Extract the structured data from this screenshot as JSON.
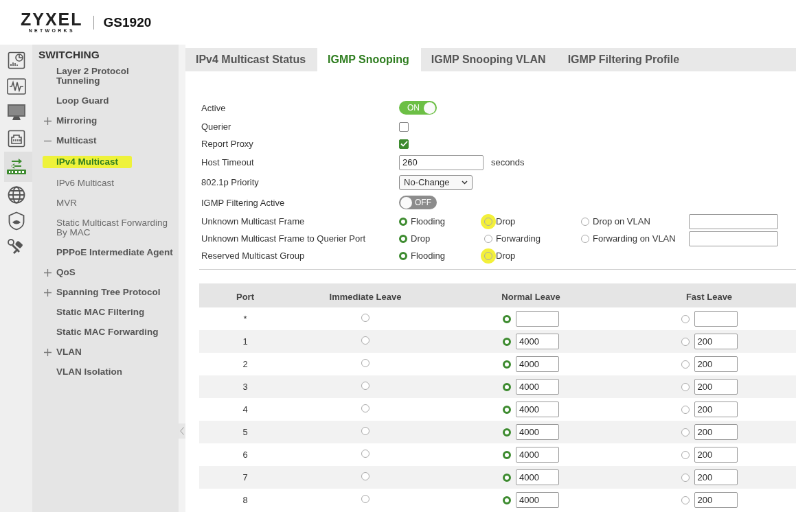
{
  "header": {
    "logo": "ZYXEL",
    "logo_sub": "NETWORKS",
    "model": "GS1920"
  },
  "rail": [
    {
      "kind": "dashboard",
      "selected": false
    },
    {
      "kind": "monitor",
      "selected": false
    },
    {
      "kind": "screen",
      "selected": false
    },
    {
      "kind": "port",
      "selected": false
    },
    {
      "kind": "switching",
      "selected": true
    },
    {
      "kind": "globe",
      "selected": false
    },
    {
      "kind": "shield",
      "selected": false
    },
    {
      "kind": "tools",
      "selected": false
    }
  ],
  "sidebar": {
    "title": "SWITCHING",
    "items": [
      {
        "label": "Layer 2 Protocol Tunneling",
        "selected": false
      },
      {
        "label": "Loop Guard",
        "selected": false
      },
      {
        "label": "Mirroring",
        "selected": false,
        "expanded": false
      },
      {
        "label": "Multicast",
        "selected": false,
        "expanded": true,
        "children": [
          {
            "label": "IPv4 Multicast",
            "selected": true,
            "highlighted": true
          },
          {
            "label": "IPv6 Multicast",
            "selected": false,
            "highlighted": false
          },
          {
            "label": "MVR",
            "selected": false,
            "highlighted": false
          },
          {
            "label": "Static Multicast Forwarding By MAC",
            "selected": false,
            "highlighted": false
          }
        ]
      },
      {
        "label": "PPPoE Intermediate Agent",
        "selected": false
      },
      {
        "label": "QoS",
        "selected": false,
        "expanded": false
      },
      {
        "label": "Spanning Tree Protocol",
        "selected": false,
        "expanded": false
      },
      {
        "label": "Static MAC Filtering",
        "selected": false
      },
      {
        "label": "Static MAC Forwarding",
        "selected": false
      },
      {
        "label": "VLAN",
        "selected": false,
        "expanded": false
      },
      {
        "label": "VLAN Isolation",
        "selected": false
      }
    ]
  },
  "tabs": [
    {
      "label": "IPv4 Multicast Status",
      "selected": false
    },
    {
      "label": "IGMP Snooping",
      "selected": true
    },
    {
      "label": "IGMP Snooping VLAN",
      "selected": false
    },
    {
      "label": "IGMP Filtering Profile",
      "selected": false
    }
  ],
  "settings": [
    {
      "kind": "toggle",
      "label": "Active",
      "on": true,
      "state_text": "ON"
    },
    {
      "kind": "checkbox",
      "label": "Querier",
      "checked": false
    },
    {
      "kind": "checkbox",
      "label": "Report Proxy",
      "checked": true
    },
    {
      "kind": "input",
      "label": "Host Timeout",
      "value": "260",
      "unit": "seconds"
    },
    {
      "kind": "select",
      "label": "802.1p Priority",
      "value": "No-Change"
    },
    {
      "kind": "toggle",
      "label": "IGMP Filtering Active",
      "on": false,
      "state_text": "OFF"
    },
    {
      "kind": "radio",
      "label": "Unknown Multicast Frame",
      "options": [
        {
          "label": "Flooding",
          "selected": true,
          "highlighted": false
        },
        {
          "label": "Drop",
          "selected": false,
          "highlighted": true
        },
        {
          "label": "Drop on VLAN",
          "selected": false,
          "highlighted": false,
          "field": true
        }
      ]
    },
    {
      "kind": "radio",
      "label": "Unknown Multicast Frame to Querier Port",
      "options": [
        {
          "label": "Drop",
          "selected": true,
          "highlighted": false
        },
        {
          "label": "Forwarding",
          "selected": false,
          "highlighted": false
        },
        {
          "label": "Forwarding on VLAN",
          "selected": false,
          "highlighted": false,
          "field": true
        }
      ]
    },
    {
      "kind": "radio",
      "label": "Reserved Multicast Group",
      "options": [
        {
          "label": "Flooding",
          "selected": true,
          "highlighted": false
        },
        {
          "label": "Drop",
          "selected": false,
          "highlighted": true
        }
      ]
    }
  ],
  "table": {
    "columns": [
      "Port",
      "Immediate Leave",
      "Normal Leave",
      "Fast Leave"
    ],
    "rows": [
      {
        "port": "*",
        "immediate": {
          "selected": false
        },
        "normal": {
          "selected": true
        },
        "fast": {
          "selected": false
        }
      },
      {
        "port": "1",
        "immediate": {
          "selected": false
        },
        "normal": {
          "selected": true,
          "value": "4000"
        },
        "fast": {
          "selected": false,
          "value": "200"
        }
      },
      {
        "port": "2",
        "immediate": {
          "selected": false
        },
        "normal": {
          "selected": true,
          "value": "4000"
        },
        "fast": {
          "selected": false,
          "value": "200"
        }
      },
      {
        "port": "3",
        "immediate": {
          "selected": false
        },
        "normal": {
          "selected": true,
          "value": "4000"
        },
        "fast": {
          "selected": false,
          "value": "200"
        }
      },
      {
        "port": "4",
        "immediate": {
          "selected": false
        },
        "normal": {
          "selected": true,
          "value": "4000"
        },
        "fast": {
          "selected": false,
          "value": "200"
        }
      },
      {
        "port": "5",
        "immediate": {
          "selected": false
        },
        "normal": {
          "selected": true,
          "value": "4000"
        },
        "fast": {
          "selected": false,
          "value": "200"
        }
      },
      {
        "port": "6",
        "immediate": {
          "selected": false
        },
        "normal": {
          "selected": true,
          "value": "4000"
        },
        "fast": {
          "selected": false,
          "value": "200"
        }
      },
      {
        "port": "7",
        "immediate": {
          "selected": false
        },
        "normal": {
          "selected": true,
          "value": "4000"
        },
        "fast": {
          "selected": false,
          "value": "200"
        }
      },
      {
        "port": "8",
        "immediate": {
          "selected": false
        },
        "normal": {
          "selected": true,
          "value": "4000"
        },
        "fast": {
          "selected": false,
          "value": "200"
        }
      }
    ]
  }
}
